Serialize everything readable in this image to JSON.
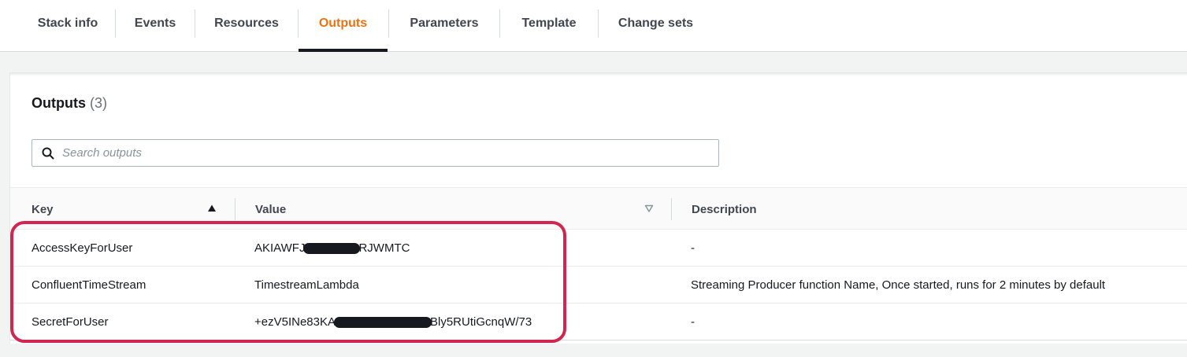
{
  "tabs": [
    {
      "label": "Stack info",
      "active": false
    },
    {
      "label": "Events",
      "active": false
    },
    {
      "label": "Resources",
      "active": false
    },
    {
      "label": "Outputs",
      "active": true
    },
    {
      "label": "Parameters",
      "active": false
    },
    {
      "label": "Template",
      "active": false
    },
    {
      "label": "Change sets",
      "active": false
    }
  ],
  "section": {
    "title": "Outputs",
    "count": "(3)"
  },
  "search": {
    "placeholder": "Search outputs",
    "value": "",
    "icon": "search-icon"
  },
  "table": {
    "columns": [
      {
        "label": "Key",
        "sort": "ascending",
        "icon": "sort-ascending-icon"
      },
      {
        "label": "Value",
        "sort": "none",
        "icon": "sort-icon"
      },
      {
        "label": "Description"
      }
    ],
    "rows": [
      {
        "key": "AccessKeyForUser",
        "value_start": "AKIAWFJ",
        "value_end": "RJWMTC",
        "description": "-"
      },
      {
        "key": "ConfluentTimeStream",
        "value_start": "TimestreamLambda",
        "value_end": "",
        "description": "Streaming Producer function Name, Once started, runs for 2 minutes by default"
      },
      {
        "key": "SecretForUser",
        "value_start": "+ezV5INe83KA",
        "value_end": "Bly5RUtiGcnqW/73",
        "description": "-"
      }
    ]
  },
  "colors": {
    "active_tab": "#ec7211",
    "highlight": "#d1264f",
    "redaction": "#16191f"
  }
}
